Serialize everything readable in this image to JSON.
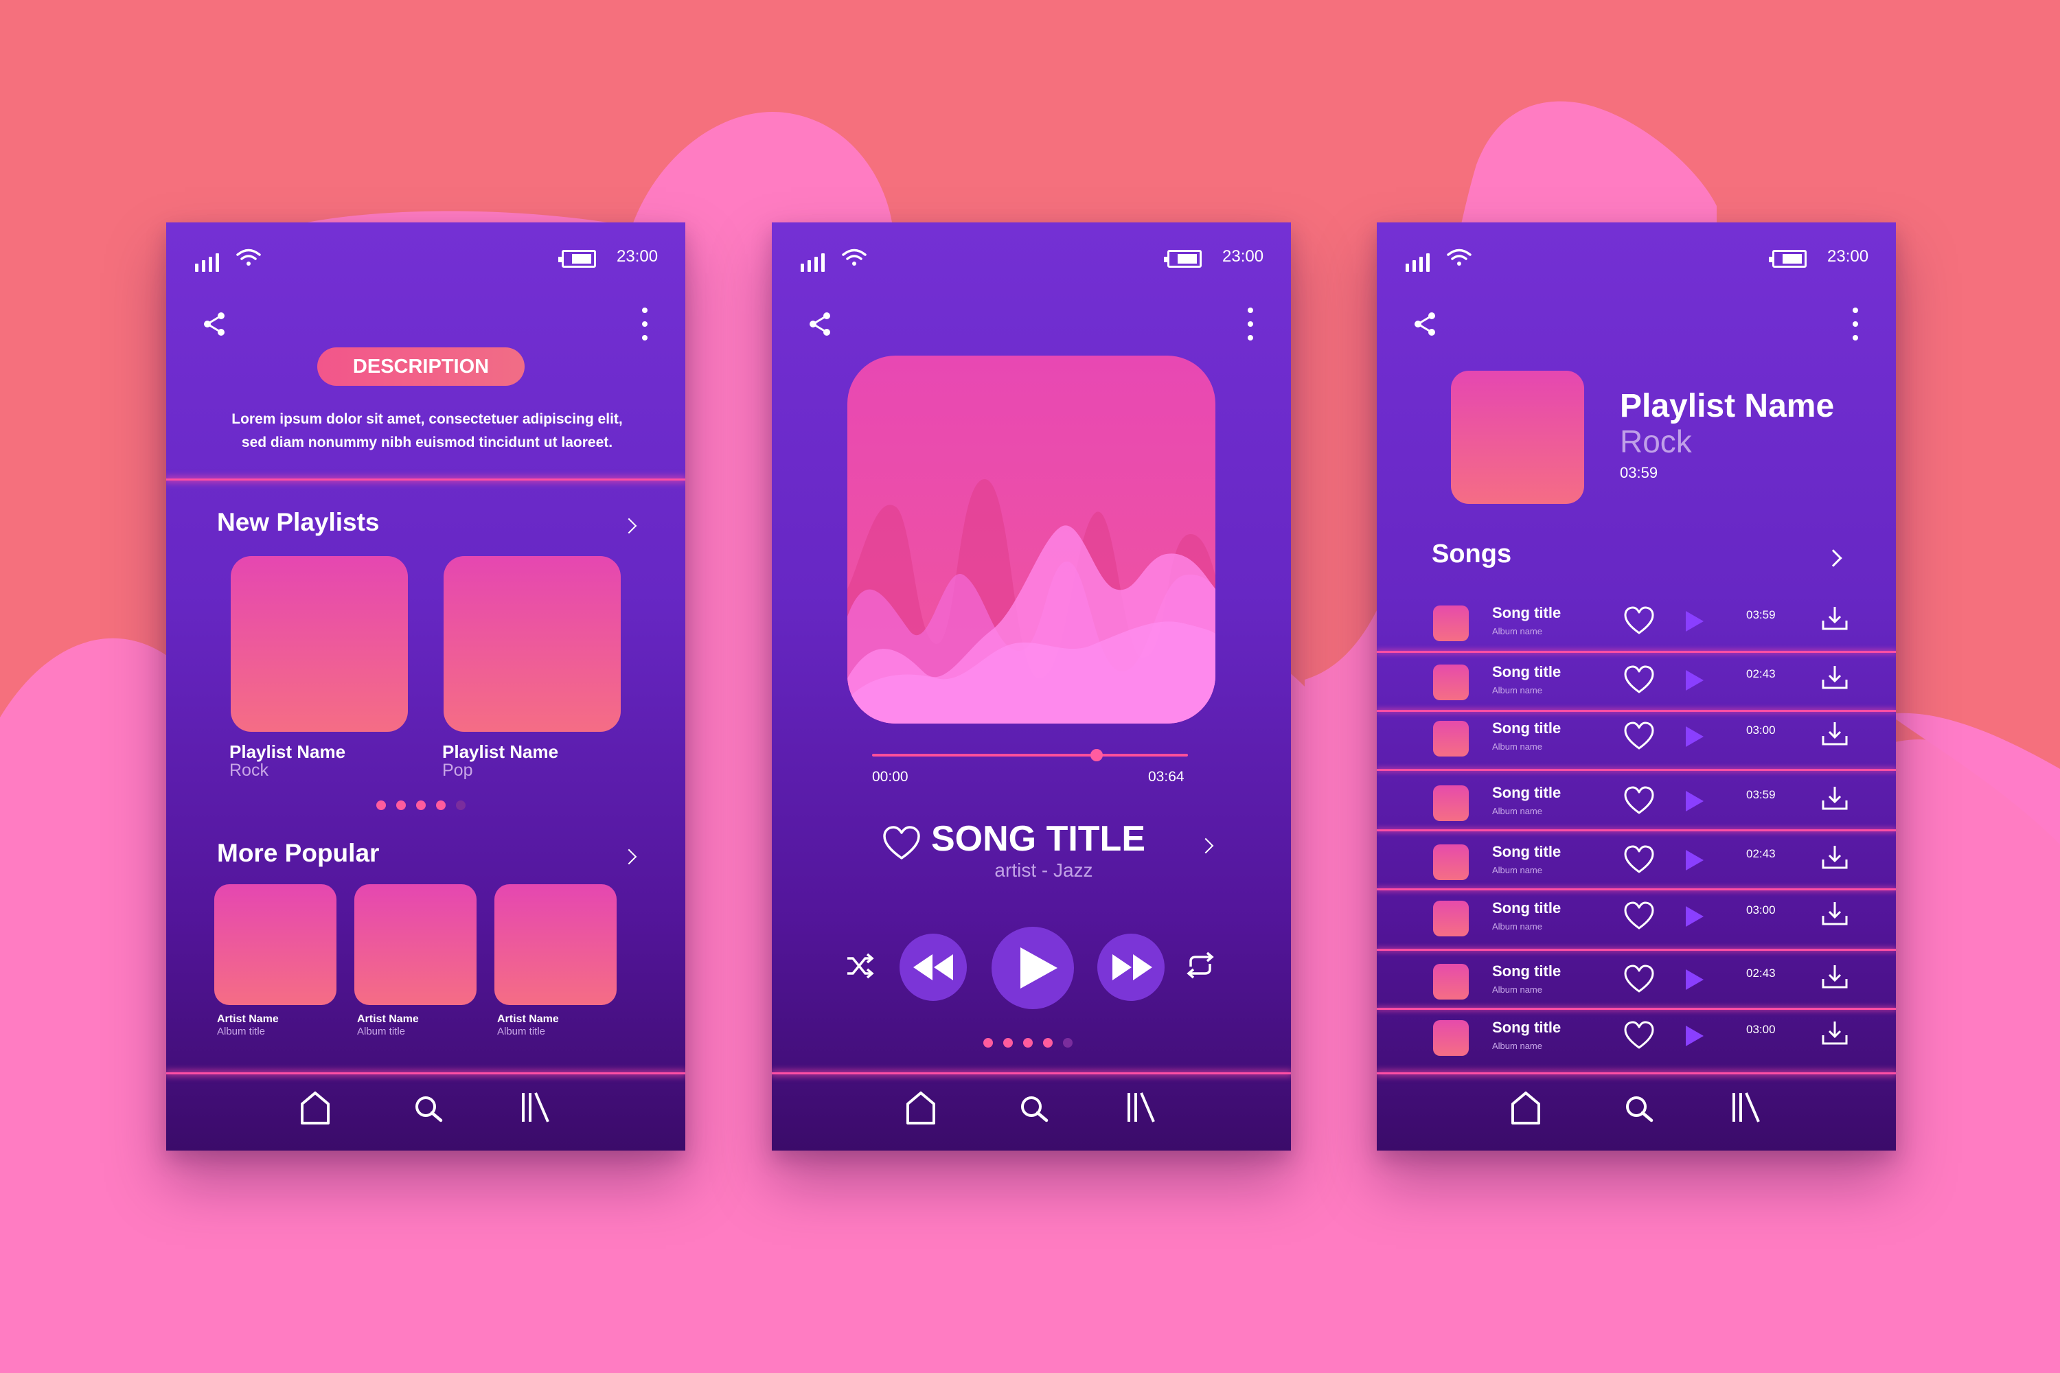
{
  "colors": {
    "background_top": "#f5707d",
    "background_wave": "#ff78c2",
    "phone_top": "#7430d4",
    "phone_bottom": "#3b0b6a",
    "accent_pink": "#ff4fa4",
    "tile_gradient": [
      "#e547b1",
      "#f56d85"
    ],
    "play_purple": "#8a3fff"
  },
  "status_bar": {
    "time": "23:00"
  },
  "screen_description": {
    "button_label": "DESCRIPTION",
    "text": "Lorem ipsum dolor sit amet, consectetuer adipiscing elit, sed diam nonummy nibh euismod tincidunt ut laoreet.",
    "new_playlists": {
      "title": "New Playlists",
      "items": [
        {
          "name": "Playlist Name",
          "genre": "Rock"
        },
        {
          "name": "Playlist Name",
          "genre": "Pop"
        }
      ],
      "page_dots": 5,
      "active_dots": 4
    },
    "more_popular": {
      "title": "More Popular",
      "items": [
        {
          "artist": "Artist Name",
          "album": "Album title"
        },
        {
          "artist": "Artist Name",
          "album": "Album title"
        },
        {
          "artist": "Artist Name",
          "album": "Album title"
        }
      ]
    }
  },
  "screen_player": {
    "current_time": "00:00",
    "total_time": "03:64",
    "progress": 0.71,
    "song_title": "SONG TITLE",
    "artist_genre": "artist - Jazz",
    "page_dots": 5,
    "active_dots": 4
  },
  "screen_playlist": {
    "playlist_name": "Playlist Name",
    "genre": "Rock",
    "duration": "03:59",
    "songs_title": "Songs",
    "songs": [
      {
        "title": "Song title",
        "album": "Album name",
        "duration": "03:59"
      },
      {
        "title": "Song title",
        "album": "Album name",
        "duration": "02:43"
      },
      {
        "title": "Song title",
        "album": "Album name",
        "duration": "03:00"
      },
      {
        "title": "Song title",
        "album": "Album name",
        "duration": "03:59"
      },
      {
        "title": "Song title",
        "album": "Album name",
        "duration": "02:43"
      },
      {
        "title": "Song title",
        "album": "Album name",
        "duration": "03:00"
      },
      {
        "title": "Song title",
        "album": "Album name",
        "duration": "02:43"
      },
      {
        "title": "Song title",
        "album": "Album name",
        "duration": "03:00"
      }
    ]
  },
  "icons": {
    "signal": "signal-bars-icon",
    "wifi": "wifi-icon",
    "battery": "battery-icon",
    "share": "share-icon",
    "more": "more-vertical-icon",
    "home": "home-icon",
    "search": "search-icon",
    "library": "library-icon",
    "heart": "heart-icon",
    "play": "play-icon",
    "download": "download-icon",
    "shuffle": "shuffle-icon",
    "rewind": "rewind-icon",
    "fast_forward": "fast-forward-icon",
    "repeat": "repeat-icon",
    "chevron": "chevron-right-icon"
  }
}
